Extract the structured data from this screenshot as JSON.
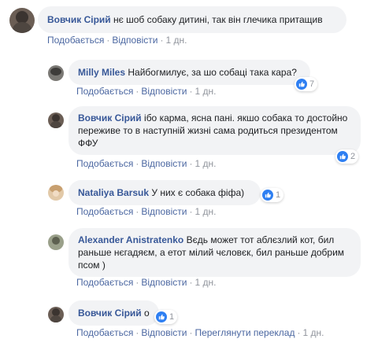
{
  "colors": {
    "author": "#385898",
    "action": "#4b67a1",
    "meta": "#90949c",
    "bubble": "#f2f3f5",
    "like": "#2e7ff2"
  },
  "actions": {
    "like": "Подобається",
    "reply": "Відповісти",
    "translate": "Переглянути переклад",
    "sep": "·"
  },
  "comments": [
    {
      "author": "Вовчик Сірий",
      "text": " нє шоб собаку дитині, так він глечика притащив",
      "time": "1 дн.",
      "reactions": ""
    },
    {
      "author": "Milly Miles",
      "text": " Найбогмилує, за шо собаці така кара?",
      "time": "1 дн.",
      "reactions": "7"
    },
    {
      "author": "Вовчик Сірий",
      "text": " ібо карма, ясна пані. якшо собака то достойно переживе то в наступній жизні сама родиться президентом ФФУ",
      "time": "1 дн.",
      "reactions": "2"
    },
    {
      "author": "Nataliya Barsuk",
      "text": " У них є собака фіфа)",
      "time": "1 дн.",
      "reactions": "1"
    },
    {
      "author": "Alexander Anistratenko",
      "text": " Вєдь может тот аблєзлий кот, бил раньше нєгадяєм, а етот мілий чєловєк, бил раньше добрим псом )",
      "time": "1 дн.",
      "reactions": ""
    },
    {
      "author": "Вовчик Сірий",
      "text": " о",
      "time": "1 дн.",
      "reactions": "1"
    }
  ]
}
